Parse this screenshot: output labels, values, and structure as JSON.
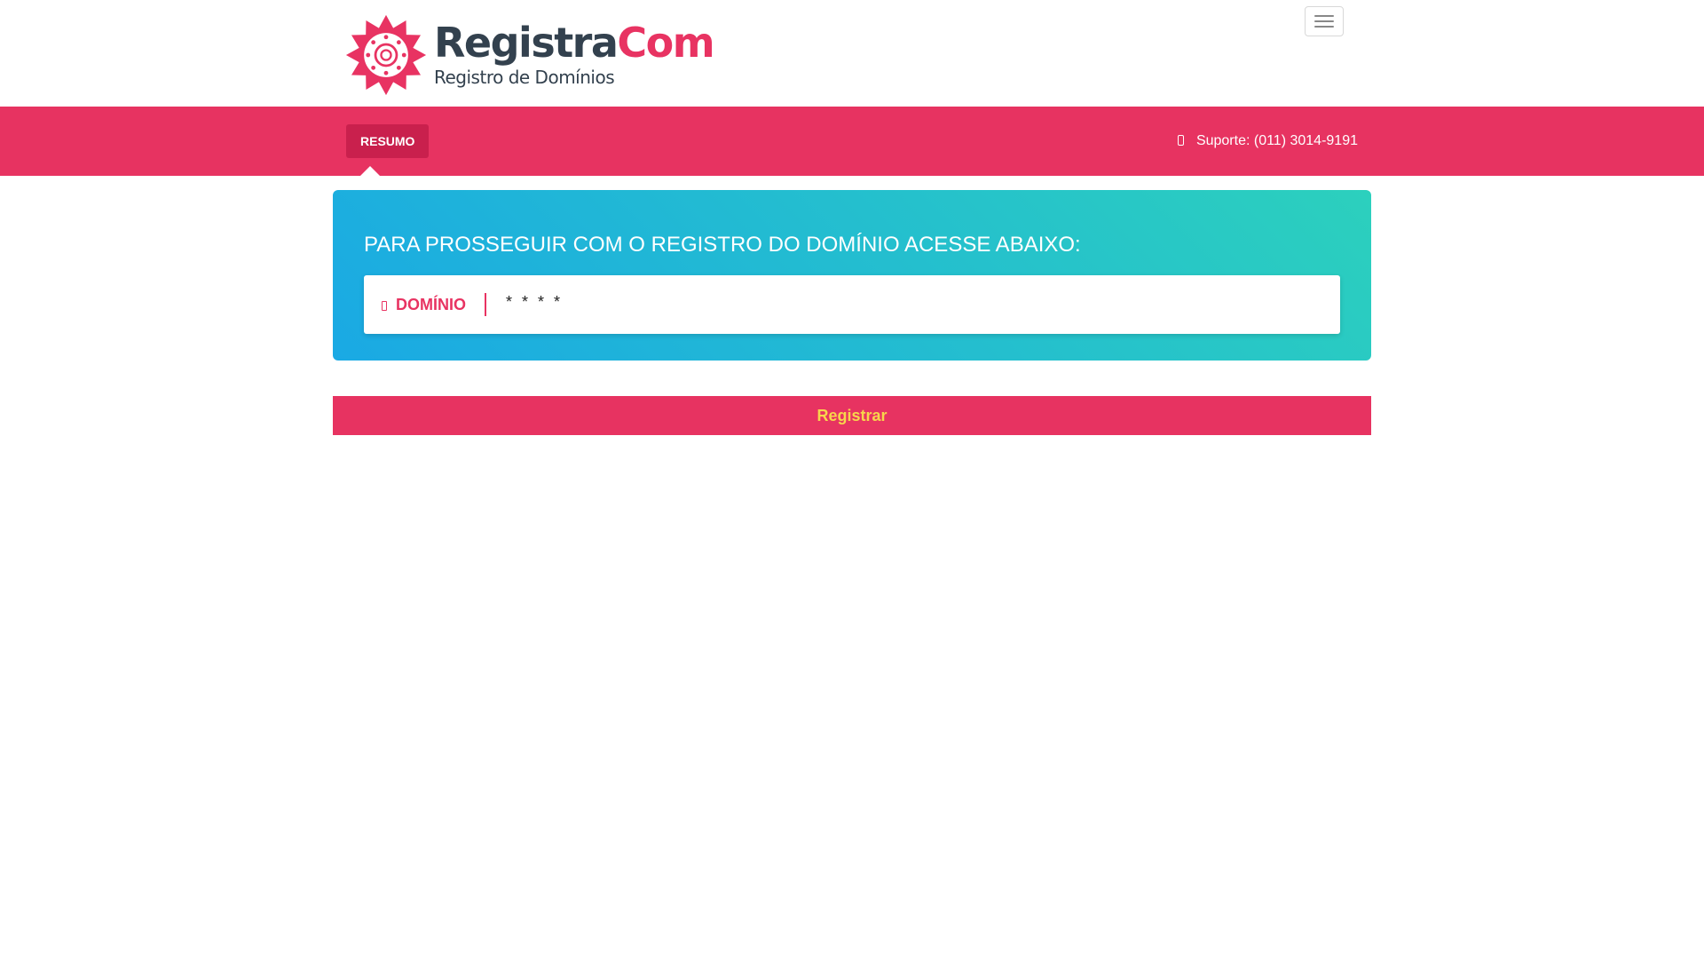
{
  "header": {
    "logo": {
      "name_part1": "Registra",
      "name_part2": "Com",
      "subtitle": "Registro de Domínios"
    },
    "menu_icon": "hamburger-menu-icon"
  },
  "nav": {
    "tab_label": "RESUMO",
    "support_text": "Suporte: (011) 3014-9191",
    "support_icon": "phone-icon"
  },
  "main": {
    "title": "PARA PROSSEGUIR COM O REGISTRO DO DOMÍNIO ACESSE ABAIXO:",
    "domain_label": "DOMÍNIO",
    "domain_icon": "globe-icon",
    "domain_value": "* * * *",
    "register_label": "Registrar"
  },
  "colors": {
    "brand": "#e73361",
    "brand_dark": "#c9204d",
    "gradient_start": "#1aa9e4",
    "gradient_end": "#2cd0bd",
    "button_text": "#f7d64b",
    "logo_dark": "#33414e"
  }
}
